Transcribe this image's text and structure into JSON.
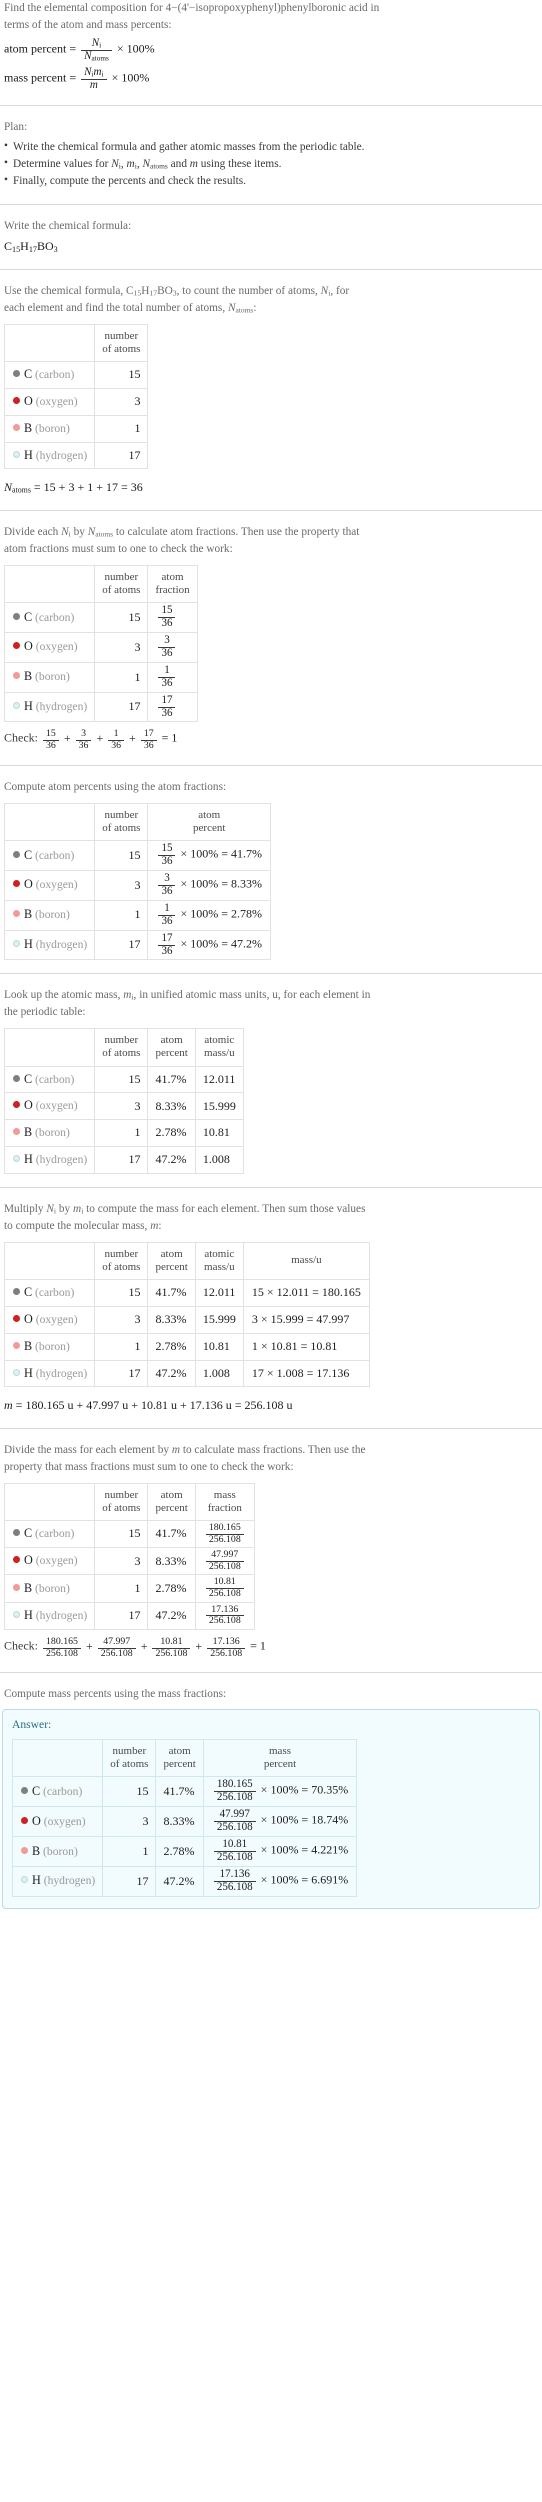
{
  "problem": {
    "intro_line1": "Find the elemental composition for 4−(4'−isopropoxyphenyl)phenylboronic acid in",
    "intro_line2": "terms of the atom and mass percents:",
    "atom_percent_label": "atom percent",
    "mass_percent_label": "mass percent",
    "equals": "=",
    "times_100": "× 100%",
    "atom_percent_num": "N",
    "atom_percent_num_sub": "i",
    "atom_percent_den": "N",
    "atom_percent_den_sub": "atoms",
    "mass_percent_num": "N",
    "mass_percent_num_sub": "i",
    "mass_percent_num2": "m",
    "mass_percent_num2_sub": "i",
    "mass_percent_den": "m"
  },
  "plan": {
    "title": "Plan:",
    "items": [
      "Write the chemical formula and gather atomic masses from the periodic table.",
      "Determine values for Nᵢ, mᵢ, N_atoms and m using these items.",
      "Finally, compute the percents and check the results."
    ],
    "item2_parts": {
      "pre": "Determine values for ",
      "v1": "N",
      "v1sub": "i",
      "sep1": ", ",
      "v2": "m",
      "v2sub": "i",
      "sep2": ", ",
      "v3": "N",
      "v3sub": "atoms",
      "mid": " and ",
      "v4": "m",
      "post": " using these items."
    }
  },
  "formula_section": {
    "prompt": "Write the chemical formula:",
    "formula_parts": [
      {
        "el": "C",
        "count": "15"
      },
      {
        "el": "H",
        "count": "17"
      },
      {
        "el": "B",
        "count": ""
      },
      {
        "el": "O",
        "count": "3"
      }
    ],
    "formula_plain": "C15H17BO3"
  },
  "count_section": {
    "prompt_pre": "Use the chemical formula, ",
    "prompt_mid": ", to count the number of atoms, ",
    "prompt_var": "N",
    "prompt_var_sub": "i",
    "prompt_post": ", for",
    "prompt_line2_pre": "each element and find the total number of atoms, ",
    "prompt_line2_var": "N",
    "prompt_line2_var_sub": "atoms",
    "prompt_line2_post": ":",
    "headers": [
      "",
      "number of atoms"
    ],
    "header_number": "number",
    "header_of_atoms": "of atoms",
    "total_line": "N",
    "total_sub": "atoms",
    "total_expr": "= 15 + 3 + 1 + 17 = 36"
  },
  "fraction_section": {
    "prompt_line1_pre": "Divide each ",
    "prompt_v1": "N",
    "prompt_v1sub": "i",
    "prompt_mid": " by ",
    "prompt_v2": "N",
    "prompt_v2sub": "atoms",
    "prompt_line1_post": " to calculate atom fractions. Then use the property that",
    "prompt_line2": "atom fractions must sum to one to check the work:",
    "header_atom": "atom",
    "header_fraction": "fraction",
    "check_label": "Check:",
    "check_result": "= 1",
    "check_denominator": "36",
    "check_numerators": [
      "15",
      "3",
      "1",
      "17"
    ]
  },
  "atom_percent_section": {
    "prompt": "Compute atom percents using the atom fractions:",
    "header_atom": "atom",
    "header_percent": "percent"
  },
  "atomic_mass_section": {
    "prompt_line1_pre": "Look up the atomic mass, ",
    "prompt_v": "m",
    "prompt_vsub": "i",
    "prompt_line1_post": ", in unified atomic mass units, u, for each element in",
    "prompt_line2": "the periodic table:",
    "header_atomic": "atomic",
    "header_massu": "mass/u"
  },
  "mass_section": {
    "prompt_line1_pre": "Multiply ",
    "prompt_v1": "N",
    "prompt_v1sub": "i",
    "prompt_mid": " by ",
    "prompt_v2": "m",
    "prompt_v2sub": "i",
    "prompt_line1_post": " to compute the mass for each element. Then sum those values",
    "prompt_line2_pre": "to compute the molecular mass, ",
    "prompt_line2_v": "m",
    "prompt_line2_post": ":",
    "header_massu": "mass/u",
    "molecular_mass_var": "m",
    "molecular_mass_expr": "= 180.165 u + 47.997 u + 10.81 u + 17.136 u = 256.108 u"
  },
  "mass_fraction_section": {
    "prompt_line1": "Divide the mass for each element by m to calculate mass fractions. Then use the",
    "prompt_line1_pre": "Divide the mass for each element by ",
    "prompt_line1_v": "m",
    "prompt_line1_post": " to calculate mass fractions. Then use the",
    "prompt_line2": "property that mass fractions must sum to one to check the work:",
    "header_mass": "mass",
    "header_fraction": "fraction",
    "check_label": "Check:",
    "check_result": "= 1",
    "check_denominator": "256.108",
    "check_numerators": [
      "180.165",
      "47.997",
      "10.81",
      "17.136"
    ]
  },
  "answer_section": {
    "prompt": "Compute mass percents using the mass fractions:",
    "answer_label": "Answer:",
    "header_mass": "mass",
    "header_percent": "percent",
    "header_number": "number",
    "header_of_atoms": "of atoms",
    "header_atom": "atom",
    "header_atom_percent": "percent"
  },
  "elements": [
    {
      "symbol": "C",
      "name": "(carbon)",
      "color": "#7f7f7f",
      "filled": true,
      "atoms": "15",
      "atom_fraction_num": "15",
      "atom_fraction_den": "36",
      "atom_percent": "41.7%",
      "atomic_mass": "12.011",
      "mass_expr": "15 × 12.011 = 180.165",
      "mass_value": "180.165",
      "mass_fraction_num": "180.165",
      "mass_fraction_den": "256.108",
      "mass_percent": "70.35%"
    },
    {
      "symbol": "O",
      "name": "(oxygen)",
      "color": "#cc2222",
      "filled": true,
      "atoms": "3",
      "atom_fraction_num": "3",
      "atom_fraction_den": "36",
      "atom_percent": "8.33%",
      "atomic_mass": "15.999",
      "mass_expr": "3 × 15.999 = 47.997",
      "mass_value": "47.997",
      "mass_fraction_num": "47.997",
      "mass_fraction_den": "256.108",
      "mass_percent": "18.74%"
    },
    {
      "symbol": "B",
      "name": "(boron)",
      "color": "#f29b96",
      "filled": true,
      "atoms": "1",
      "atom_fraction_num": "1",
      "atom_fraction_den": "36",
      "atom_percent": "2.78%",
      "atomic_mass": "10.81",
      "mass_expr": "1 × 10.81 = 10.81",
      "mass_value": "10.81",
      "mass_fraction_num": "10.81",
      "mass_fraction_den": "256.108",
      "mass_percent": "4.221%"
    },
    {
      "symbol": "H",
      "name": "(hydrogen)",
      "color": "#ddf0f2",
      "filled": false,
      "atoms": "17",
      "atom_fraction_num": "17",
      "atom_fraction_den": "36",
      "atom_percent": "47.2%",
      "atomic_mass": "1.008",
      "mass_expr": "17 × 1.008 = 17.136",
      "mass_value": "17.136",
      "mass_fraction_num": "17.136",
      "mass_fraction_den": "256.108",
      "mass_percent": "6.691%"
    }
  ],
  "symbols": {
    "times": "×",
    "percent_100": "100%",
    "equals": "=",
    "plus": "+",
    "unit_u": "u"
  }
}
